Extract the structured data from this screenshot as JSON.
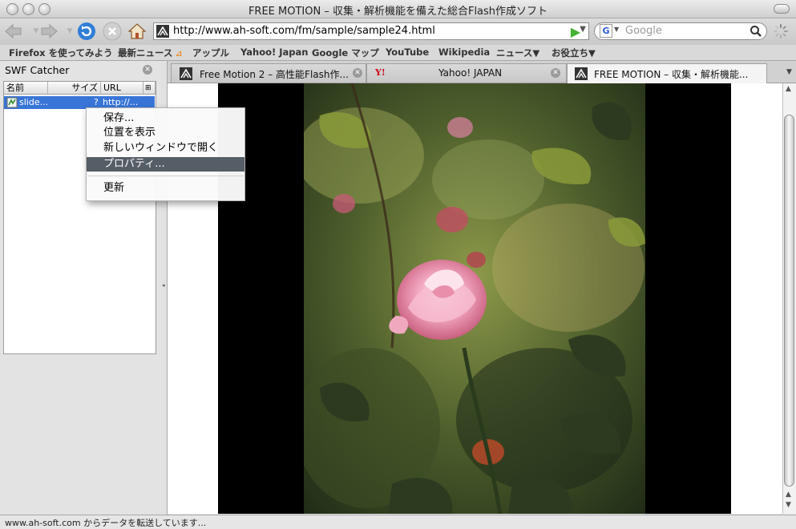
{
  "window": {
    "title": "FREE MOTION – 収集・解析機能を備えた総合Flash作成ソフト"
  },
  "toolbar": {
    "url": "http://www.ah-soft.com/fm/sample/sample24.html",
    "search_placeholder": "Google"
  },
  "bookmarks": [
    "Firefox を使ってみよう",
    "最新ニュース",
    "アップル",
    "Yahoo! Japan",
    "Google マップ",
    "YouTube",
    "Wikipedia",
    "ニュース▼",
    "お役立ち▼"
  ],
  "sidebar": {
    "title": "SWF Catcher",
    "columns": [
      "名前",
      "サイズ",
      "URL",
      "⊞"
    ],
    "rows": [
      {
        "name": "slide...",
        "size": "?",
        "url": "http://..."
      }
    ]
  },
  "context_menu": {
    "items": [
      "保存...",
      "位置を表示",
      "新しいウィンドウで開く",
      "プロパティ...",
      "更新"
    ],
    "highlighted": 3
  },
  "tabs": [
    {
      "label": "Free Motion 2 – 高性能Flash作...",
      "active": false
    },
    {
      "label": "Yahoo! JAPAN",
      "active": false
    },
    {
      "label": "FREE MOTION – 収集・解析機能...",
      "active": true
    }
  ],
  "status": {
    "text": "www.ah-soft.com からデータを転送しています..."
  },
  "colors": {
    "selection": "#3875d7",
    "menu_highlight": "#555d66"
  }
}
